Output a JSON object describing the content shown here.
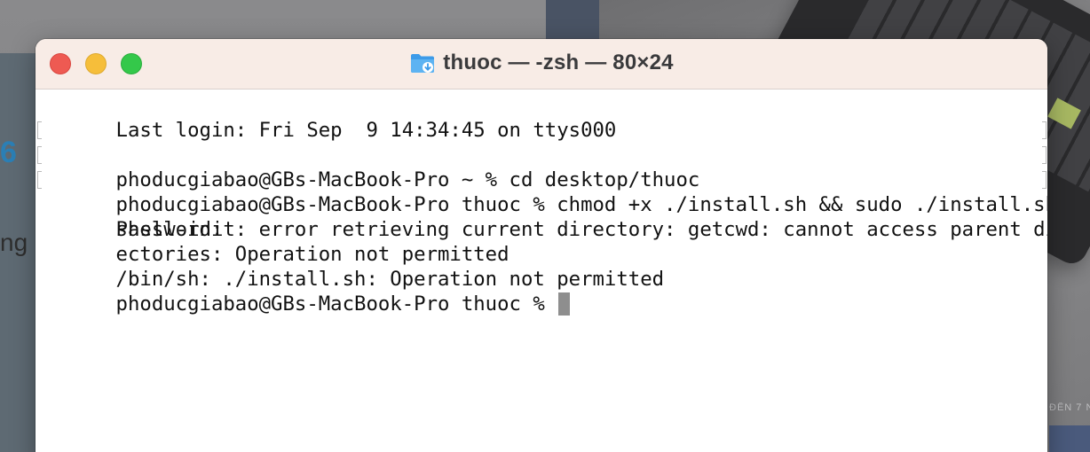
{
  "background": {
    "partial_text_1": "6",
    "partial_text_2": "ng",
    "caption_fragment": "ĐẾN 7 N"
  },
  "window": {
    "title": "thuoc — -zsh — 80×24",
    "folder_icon": "folder-download-icon",
    "buttons": {
      "close": "close-window-button",
      "minimize": "minimize-window-button",
      "zoom": "zoom-window-button"
    }
  },
  "terminal": {
    "lines": [
      "Last login: Fri Sep  9 14:34:45 on ttys000",
      "phoducgiabao@GBs-MacBook-Pro ~ % cd desktop/thuoc",
      "phoducgiabao@GBs-MacBook-Pro thuoc % chmod +x ./install.sh && sudo ./install.sh",
      "Password:",
      "shell-init: error retrieving current directory: getcwd: cannot access parent dir",
      "ectories: Operation not permitted",
      "/bin/sh: ./install.sh: Operation not permitted",
      "phoducgiabao@GBs-MacBook-Pro thuoc % "
    ]
  },
  "colors": {
    "titlebar": "#f8ece6",
    "close": "#ee5a52",
    "minimize": "#f6be3a",
    "zoom": "#34c84a",
    "cursor": "#8e8e8e",
    "folder": "#3d9be9"
  }
}
